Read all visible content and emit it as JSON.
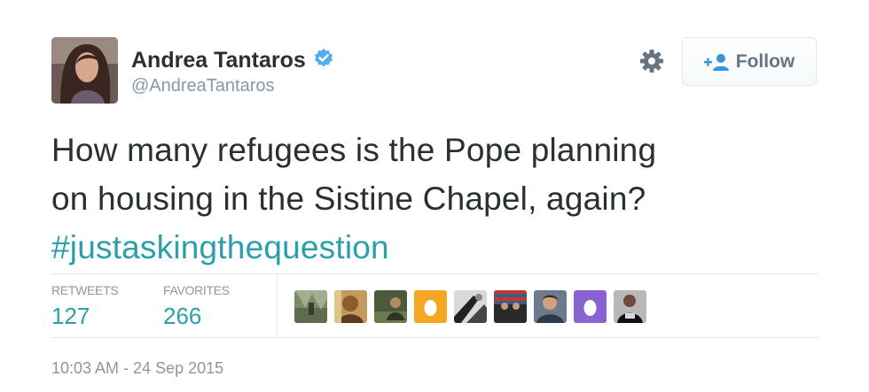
{
  "user": {
    "display_name": "Andrea Tantaros",
    "handle": "@AndreaTantaros",
    "verified": true,
    "avatar_icon": "profile-photo"
  },
  "actions": {
    "settings_icon": "gear-icon",
    "follow_label": "Follow",
    "follow_icon": "add-user-icon"
  },
  "tweet": {
    "lines": [
      "How many refugees is the Pope planning",
      "on housing in the Sistine Chapel, again?"
    ],
    "hashtag": "#justaskingthequestion"
  },
  "stats": {
    "retweets_label": "RETWEETS",
    "retweets_value": "127",
    "favorites_label": "FAVORITES",
    "favorites_value": "266"
  },
  "favoriters": [
    {
      "name": "favoriter-avatar-1",
      "kind": "photo"
    },
    {
      "name": "favoriter-avatar-2",
      "kind": "photo"
    },
    {
      "name": "favoriter-avatar-3",
      "kind": "photo"
    },
    {
      "name": "favoriter-avatar-4",
      "kind": "egg"
    },
    {
      "name": "favoriter-avatar-5",
      "kind": "photo"
    },
    {
      "name": "favoriter-avatar-6",
      "kind": "photo"
    },
    {
      "name": "favoriter-avatar-7",
      "kind": "photo"
    },
    {
      "name": "favoriter-avatar-8",
      "kind": "egg"
    },
    {
      "name": "favoriter-avatar-9",
      "kind": "photo"
    }
  ],
  "timestamp": "10:03 AM - 24 Sep 2015",
  "colors": {
    "link": "#2b9fab",
    "verified": "#55acee",
    "muted": "#8899a6",
    "text": "#292f33",
    "egg_orange": "#f5a623",
    "egg_purple": "#8a63d2"
  }
}
